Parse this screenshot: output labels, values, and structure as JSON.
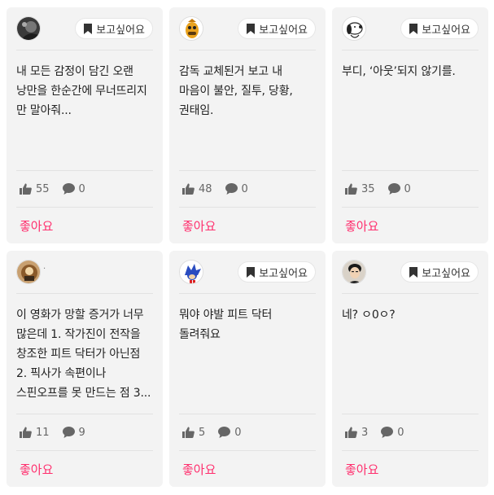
{
  "colors": {
    "card_bg": "#f3f3f3",
    "accent": "#ff2f6e",
    "icon": "#666666"
  },
  "want_label": "보고싶어요",
  "like_label": "좋아요",
  "cards": [
    {
      "avatar": "user-photo-avatar",
      "has_want": true,
      "text": "내 모든 감정이 담긴 오랜 낭만을 한순간에 무너뜨리지 만 말아줘...",
      "likes": "55",
      "comments": "0"
    },
    {
      "avatar": "cartoon-character-avatar",
      "has_want": true,
      "text": "감독 교체된거 보고 내 마음이 불안, 질투, 당황, 권태임.",
      "likes": "48",
      "comments": "0"
    },
    {
      "avatar": "snoopy-avatar",
      "has_want": true,
      "text": "부디, ‘아웃’되지 않기를.",
      "likes": "35",
      "comments": "0"
    },
    {
      "avatar": "figure-photo-avatar",
      "has_want": false,
      "dot": ".",
      "text": "이 영화가 망할 증거가 너무 많은데 1. 작가진이 전작을 창조한 피트 닥터가 아닌점 2. 픽사가 속편이나 스핀오프를 못 만드는 점 3...",
      "likes": "11",
      "comments": "9"
    },
    {
      "avatar": "sonic-avatar",
      "has_want": true,
      "text": "뭐야 야발 피트 닥터 돌려줘요",
      "likes": "5",
      "comments": "0"
    },
    {
      "avatar": "person-photo-avatar",
      "has_want": true,
      "text": "네? ㅇ0ㅇ?",
      "likes": "3",
      "comments": "0"
    }
  ]
}
